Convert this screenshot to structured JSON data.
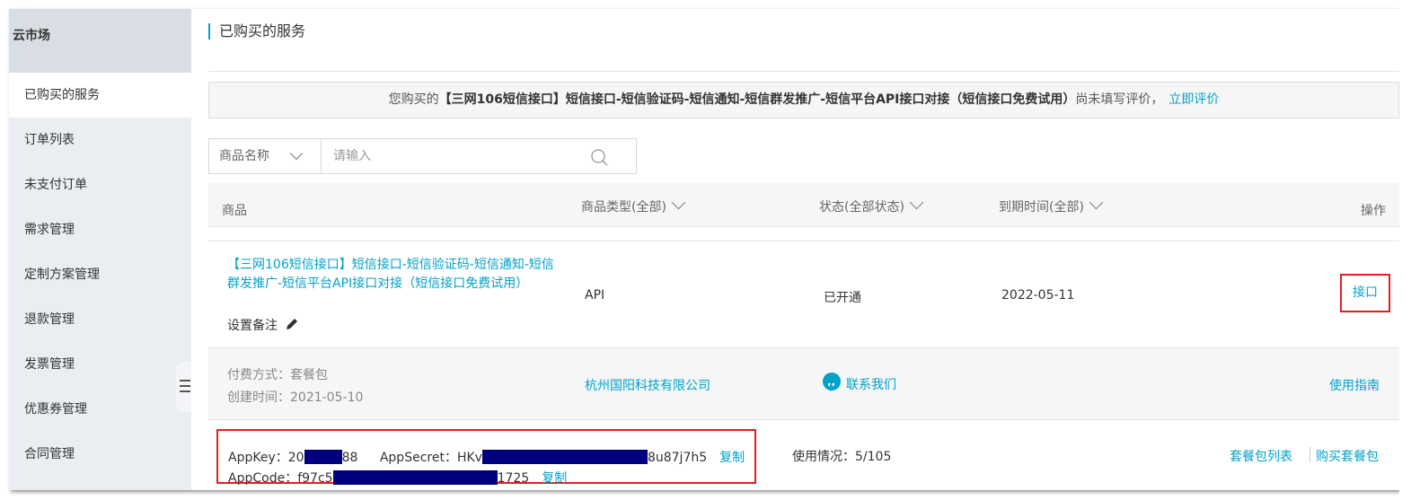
{
  "sidebar": {
    "header": "云市场",
    "items": [
      {
        "label": "已购买的服务",
        "active": true
      },
      {
        "label": "订单列表",
        "active": false
      },
      {
        "label": "未支付订单",
        "active": false
      },
      {
        "label": "需求管理",
        "active": false
      },
      {
        "label": "定制方案管理",
        "active": false
      },
      {
        "label": "退款管理",
        "active": false
      },
      {
        "label": "发票管理",
        "active": false
      },
      {
        "label": "优惠券管理",
        "active": false
      },
      {
        "label": "合同管理",
        "active": false
      }
    ]
  },
  "page": {
    "title": "已购买的服务"
  },
  "notice": {
    "prefix": "您购买的",
    "product": "【三网106短信接口】短信接口-短信验证码-短信通知-短信群发推广-短信平台API接口对接（短信接口免费试用）",
    "suffix": "尚未填写评价，",
    "action": "立即评价"
  },
  "search": {
    "filter_label": "商品名称",
    "placeholder": "请输入",
    "icons": {
      "dropdown": "chevron-down-icon",
      "search": "search-icon"
    }
  },
  "table": {
    "headers": {
      "product": "商品",
      "type": "商品类型(全部)",
      "status": "状态(全部状态)",
      "expiry": "到期时间(全部)",
      "action": "操作"
    },
    "row": {
      "product_name": "【三网106短信接口】短信接口-短信验证码-短信通知-短信群发推广-短信平台API接口对接（短信接口免费试用）",
      "remark_label": "设置备注",
      "type": "API",
      "status": "已开通",
      "expiry": "2022-05-11",
      "action": "接口",
      "payment": "付费方式：套餐包",
      "created": "创建时间：2021-05-10",
      "vendor": "杭州国阳科技有限公司",
      "contact": "联系我们",
      "guide": "使用指南",
      "credentials": {
        "appkey_label": "AppKey：",
        "appkey_start": "20",
        "appkey_end": "88",
        "appsecret_label": "AppSecret：",
        "appsecret_start": "HKv",
        "appsecret_end": "8u87j7h5",
        "appcode_label": "AppCode：",
        "appcode_start": "f97c5",
        "appcode_end": "1725",
        "copy": "复制"
      },
      "usage": "使用情况：5/105",
      "package_list": "套餐包列表",
      "buy_package": "购买套餐包"
    }
  },
  "colors": {
    "accent": "#00a2ca",
    "highlight_border": "#e02020",
    "redaction": "#00007f",
    "sidebar_bg": "#eaedf1"
  }
}
